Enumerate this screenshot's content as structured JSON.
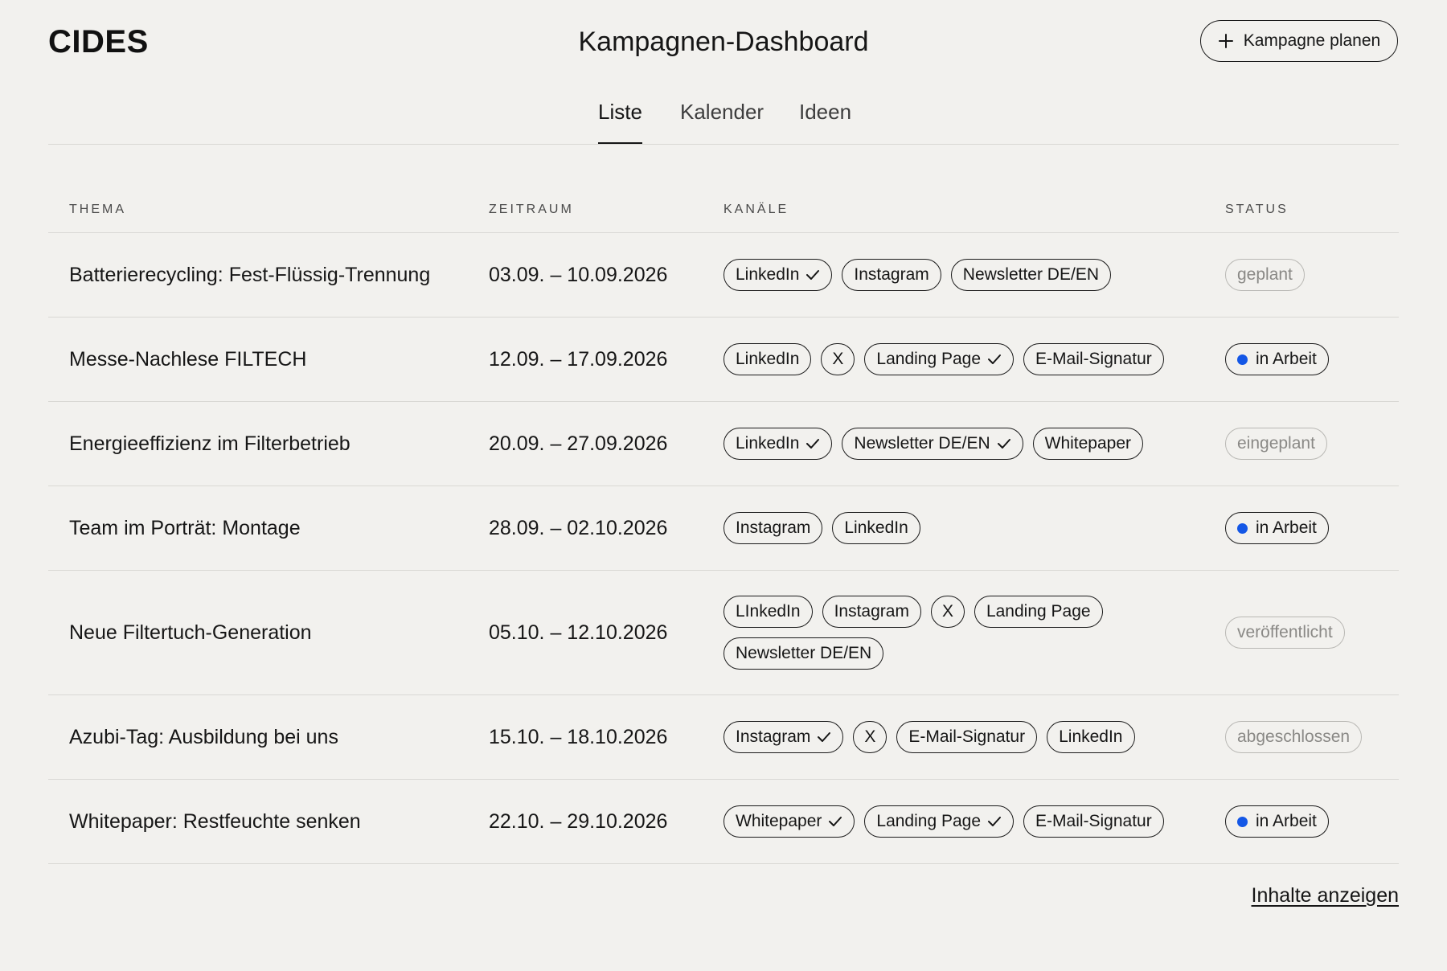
{
  "header": {
    "logo": "CIDES",
    "title": "Kampagnen-Dashboard",
    "plan_button_label": "Kampagne planen",
    "plan_button_icon": "plus-icon"
  },
  "tabs": [
    {
      "label": "Liste",
      "active": true
    },
    {
      "label": "Kalender",
      "active": false
    },
    {
      "label": "Ideen",
      "active": false
    }
  ],
  "table": {
    "columns": {
      "topic": "THEMA",
      "range": "ZEITRAUM",
      "channels": "KANÄLE",
      "status": "STATUS"
    },
    "rows": [
      {
        "topic": "Batterierecycling: Fest-Flüssig-Trennung",
        "range": "03.09. – 10.09.2026",
        "channels": [
          {
            "label": "LinkedIn",
            "done": true
          },
          {
            "label": "Instagram",
            "done": false
          },
          {
            "label": "Newsletter DE/EN",
            "done": false
          }
        ],
        "status": {
          "label": "geplant",
          "active": false
        }
      },
      {
        "topic": "Messe-Nachlese FILTECH",
        "range": "12.09. – 17.09.2026",
        "channels": [
          {
            "label": "LinkedIn",
            "done": false
          },
          {
            "label": "X",
            "done": false
          },
          {
            "label": "Landing Page",
            "done": true
          },
          {
            "label": "E-Mail-Signatur",
            "done": false
          }
        ],
        "status": {
          "label": "in Arbeit",
          "active": true
        }
      },
      {
        "topic": "Energieeffizienz im Filterbetrieb",
        "range": "20.09. – 27.09.2026",
        "channels": [
          {
            "label": "LinkedIn",
            "done": true
          },
          {
            "label": "Newsletter DE/EN",
            "done": true
          },
          {
            "label": "Whitepaper",
            "done": false
          }
        ],
        "status": {
          "label": "eingeplant",
          "active": false
        }
      },
      {
        "topic": "Team im Porträt: Montage",
        "range": "28.09. – 02.10.2026",
        "channels": [
          {
            "label": "Instagram",
            "done": false
          },
          {
            "label": "LinkedIn",
            "done": false
          }
        ],
        "status": {
          "label": "in Arbeit",
          "active": true
        }
      },
      {
        "topic": "Neue Filtertuch-Generation",
        "range": "05.10. – 12.10.2026",
        "channels": [
          {
            "label": "LInkedIn",
            "done": false
          },
          {
            "label": "Instagram",
            "done": false
          },
          {
            "label": "X",
            "done": false
          },
          {
            "label": "Landing Page",
            "done": false
          },
          {
            "label": "Newsletter DE/EN",
            "done": false
          }
        ],
        "status": {
          "label": "veröffentlicht",
          "active": false
        }
      },
      {
        "topic": "Azubi-Tag: Ausbildung bei uns",
        "range": "15.10. – 18.10.2026",
        "channels": [
          {
            "label": "Instagram",
            "done": true
          },
          {
            "label": "X",
            "done": false
          },
          {
            "label": "E-Mail-Signatur",
            "done": false
          },
          {
            "label": "LinkedIn",
            "done": false
          }
        ],
        "status": {
          "label": "abgeschlossen",
          "active": false
        }
      },
      {
        "topic": "Whitepaper: Restfeuchte senken",
        "range": "22.10. – 29.10.2026",
        "channels": [
          {
            "label": "Whitepaper",
            "done": true
          },
          {
            "label": "Landing Page",
            "done": true
          },
          {
            "label": "E-Mail-Signatur",
            "done": false
          }
        ],
        "status": {
          "label": "in Arbeit",
          "active": true
        }
      }
    ]
  },
  "footer": {
    "show_link": "Inhalte anzeigen"
  },
  "colors": {
    "background": "#f2f1ee",
    "text": "#161616",
    "muted": "#8a8986",
    "accent_dot": "#1457e6",
    "divider": "#d9d8d4"
  }
}
